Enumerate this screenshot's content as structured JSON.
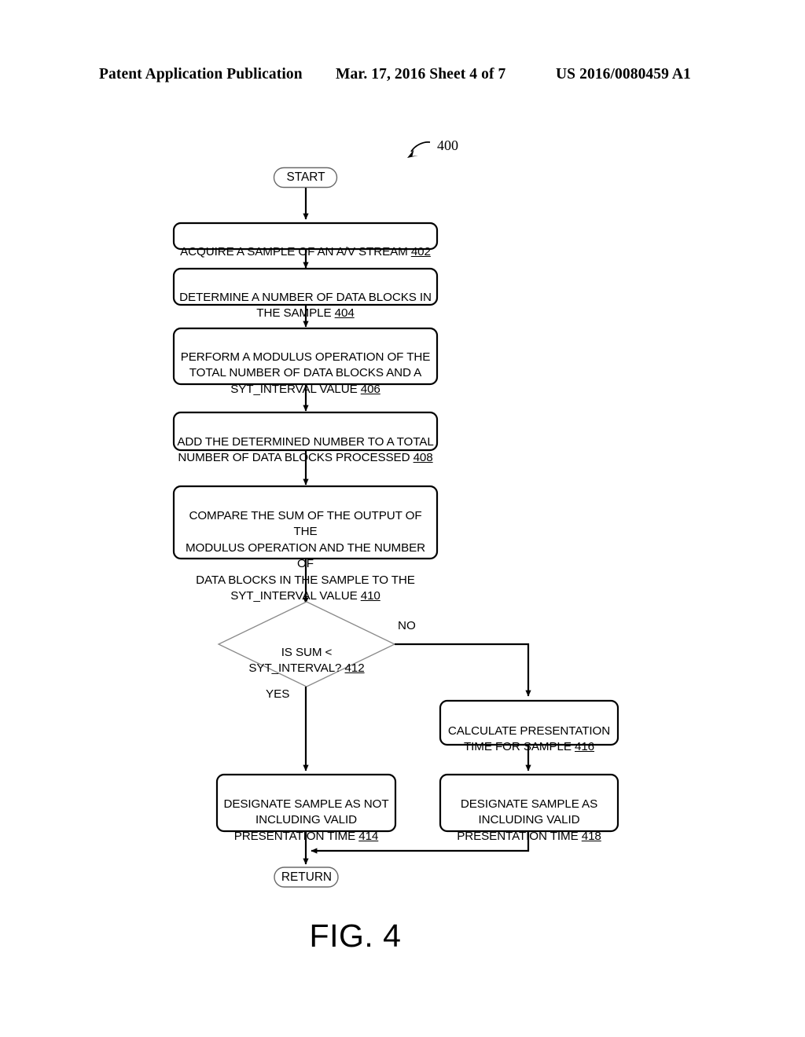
{
  "header": {
    "left": "Patent Application Publication",
    "middle": "Mar. 17, 2016  Sheet 4 of 7",
    "right": "US 2016/0080459 A1"
  },
  "figure": {
    "caption": "FIG. 4",
    "callout": "400",
    "stroke_color": "#000000",
    "thin_stroke_color": "#555555",
    "fill_color": "#ffffff"
  },
  "flowchart": {
    "start_terminal": {
      "label": "START"
    },
    "end_terminal": {
      "label": "RETURN"
    },
    "steps": [
      {
        "id": "402",
        "text": "ACQUIRE A SAMPLE OF AN A/V STREAM ",
        "ref": "402"
      },
      {
        "id": "404",
        "text": "DETERMINE A NUMBER OF DATA BLOCKS IN\nTHE SAMPLE ",
        "ref": "404"
      },
      {
        "id": "406",
        "text": "PERFORM A MODULUS OPERATION OF THE\nTOTAL NUMBER OF DATA BLOCKS AND A\nSYT_INTERVAL VALUE ",
        "ref": "406"
      },
      {
        "id": "408",
        "text": "ADD THE DETERMINED NUMBER TO A TOTAL\nNUMBER OF DATA BLOCKS PROCESSED ",
        "ref": "408"
      },
      {
        "id": "410",
        "text": "COMPARE THE SUM OF THE OUTPUT OF THE\nMODULUS OPERATION AND THE NUMBER OF\nDATA BLOCKS IN THE SAMPLE TO THE\nSYT_INTERVAL VALUE ",
        "ref": "410"
      },
      {
        "id": "414",
        "text": "DESIGNATE SAMPLE AS NOT\nINCLUDING VALID\nPRESENTATION TIME ",
        "ref": "414"
      },
      {
        "id": "416",
        "text": "CALCULATE PRESENTATION\nTIME FOR SAMPLE ",
        "ref": "416"
      },
      {
        "id": "418",
        "text": "DESIGNATE SAMPLE AS\nINCLUDING VALID\nPRESENTATION TIME ",
        "ref": "418"
      }
    ],
    "decision": {
      "id": "412",
      "text": "IS SUM <\nSYT_INTERVAL? ",
      "ref": "412",
      "branch_yes": "YES",
      "branch_no": "NO"
    }
  }
}
